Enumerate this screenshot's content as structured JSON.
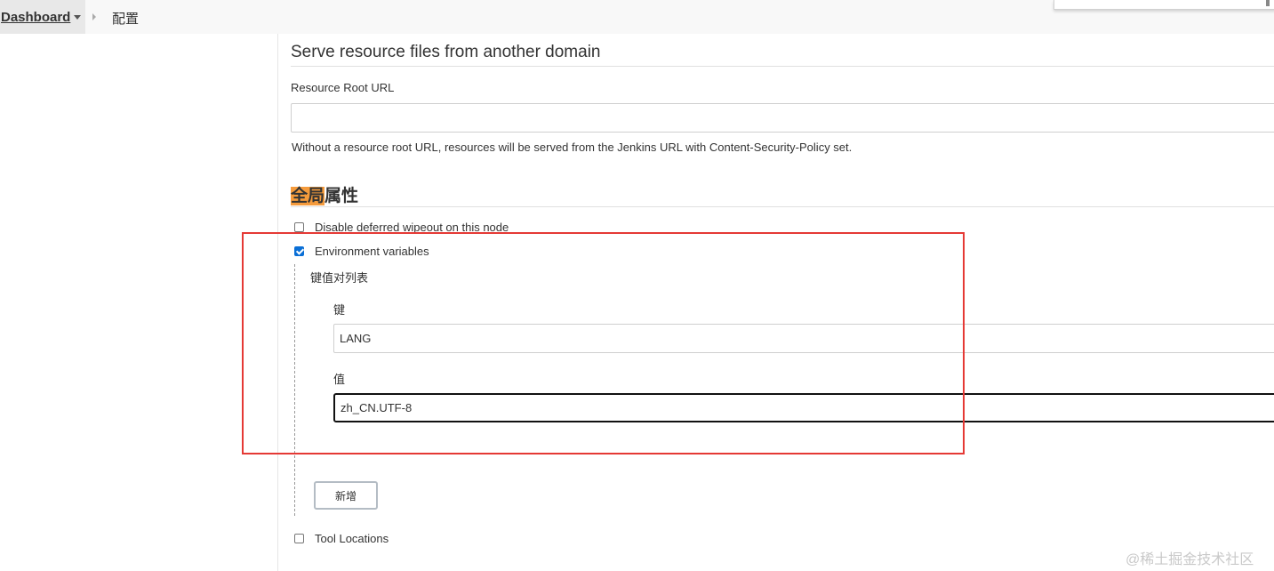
{
  "breadcrumb": {
    "dashboard_label": "Dashboard",
    "current_page": "配置"
  },
  "resource_section": {
    "title": "Serve resource files from another domain",
    "field_label": "Resource Root URL",
    "field_value": "",
    "help_text": "Without a resource root URL, resources will be served from the Jenkins URL with Content-Security-Policy set."
  },
  "global_properties": {
    "title_highlight": "全局",
    "title_rest": "属性",
    "options": [
      {
        "label": "Disable deferred wipeout on this node",
        "checked": false
      },
      {
        "label": "Environment variables",
        "checked": true
      },
      {
        "label": "Tool Locations",
        "checked": false
      }
    ],
    "env_vars": {
      "list_label": "键值对列表",
      "key_label": "键",
      "key_value": "LANG",
      "value_label": "值",
      "value_value": "zh_CN.UTF-8",
      "add_button": "新增"
    }
  },
  "watermark": "@稀土掘金技术社区",
  "colors": {
    "highlight": "#f59b3c",
    "annotation_frame": "#e53935",
    "checkbox_checked": "#0a6fd6"
  }
}
